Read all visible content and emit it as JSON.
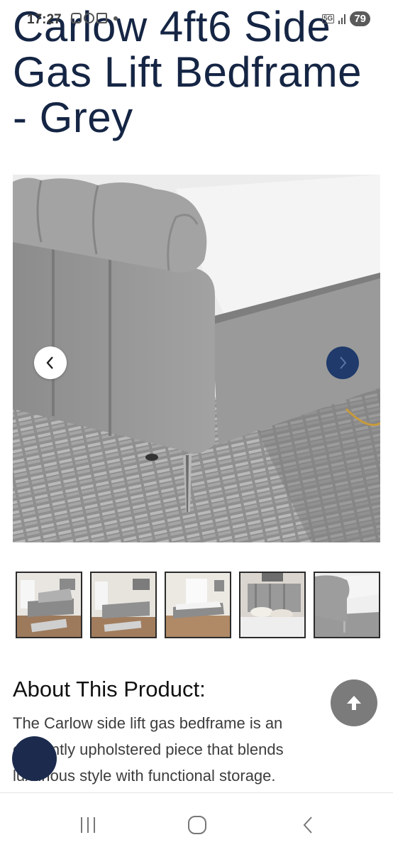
{
  "status_bar": {
    "time": "17:27",
    "network": "5G",
    "battery": "79",
    "icons": [
      "screenshot-icon",
      "whatsapp-icon",
      "gmail-icon",
      "notification-dot-icon",
      "signal-icon"
    ]
  },
  "product": {
    "title": "Carlow 4ft6 Side Gas Lift Bedframe - Grey"
  },
  "gallery": {
    "prev_icon": "chevron-left-icon",
    "next_icon": "chevron-right-icon",
    "thumbnails": [
      {
        "name": "thumbnail-1"
      },
      {
        "name": "thumbnail-2"
      },
      {
        "name": "thumbnail-3"
      },
      {
        "name": "thumbnail-4"
      },
      {
        "name": "thumbnail-5"
      }
    ]
  },
  "about": {
    "heading": "About This Product:",
    "body": "The Carlow side lift gas bedframe is an elegantly upholstered piece that blends luxurious style with functional storage."
  },
  "colors": {
    "title": "#152544",
    "accent_navy": "#1f3a6b",
    "scroll_top_bg": "#7b7b7b",
    "chat_bg": "#1c2b4d"
  },
  "bottom_nav": {
    "recents_icon": "recents-icon",
    "home_icon": "home-icon",
    "back_icon": "back-icon"
  }
}
